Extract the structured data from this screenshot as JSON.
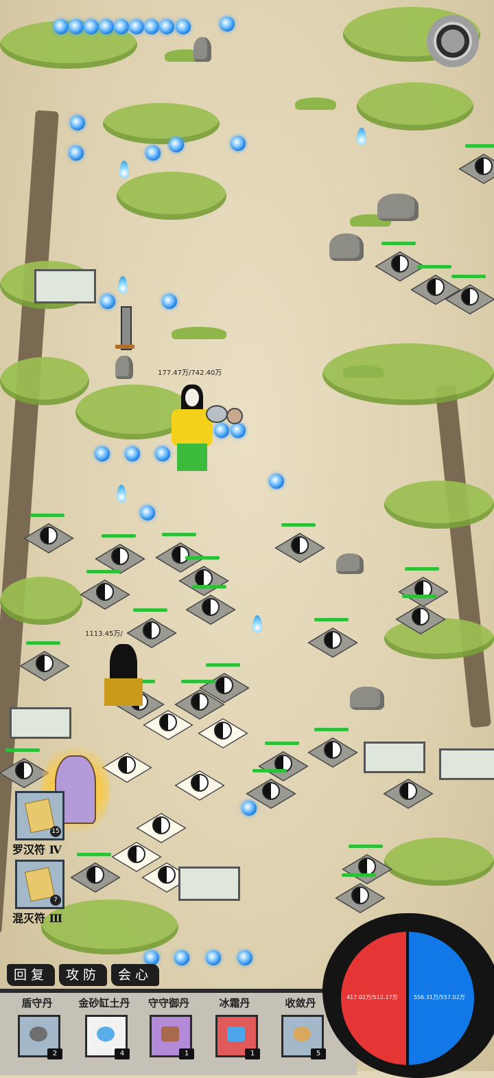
{
  "player": {
    "hp_text": "177.47万/742.40万"
  },
  "ally": {
    "hp_text": "1113.45万/"
  },
  "skills": [
    {
      "label": "罗汉符 Ⅳ",
      "count": "15"
    },
    {
      "label": "混灭符 Ⅲ",
      "count": "7"
    }
  ],
  "tabs": [
    "回复",
    "攻防",
    "会心"
  ],
  "items": [
    {
      "label": "盾守丹",
      "count": "2"
    },
    {
      "label": "金砂缸土丹",
      "count": "4"
    },
    {
      "label": "守守御丹",
      "count": "1"
    },
    {
      "label": "冰霜丹",
      "count": "1"
    },
    {
      "label": "收敛丹",
      "count": "5"
    }
  ],
  "gauge": {
    "left_text": "417.02万/512.17万",
    "right_text": "556.31万/557.02万"
  },
  "colors": {
    "hp_red": "#e53535",
    "mana_blue": "#1278e8",
    "health_green": "#2fbf3a"
  }
}
